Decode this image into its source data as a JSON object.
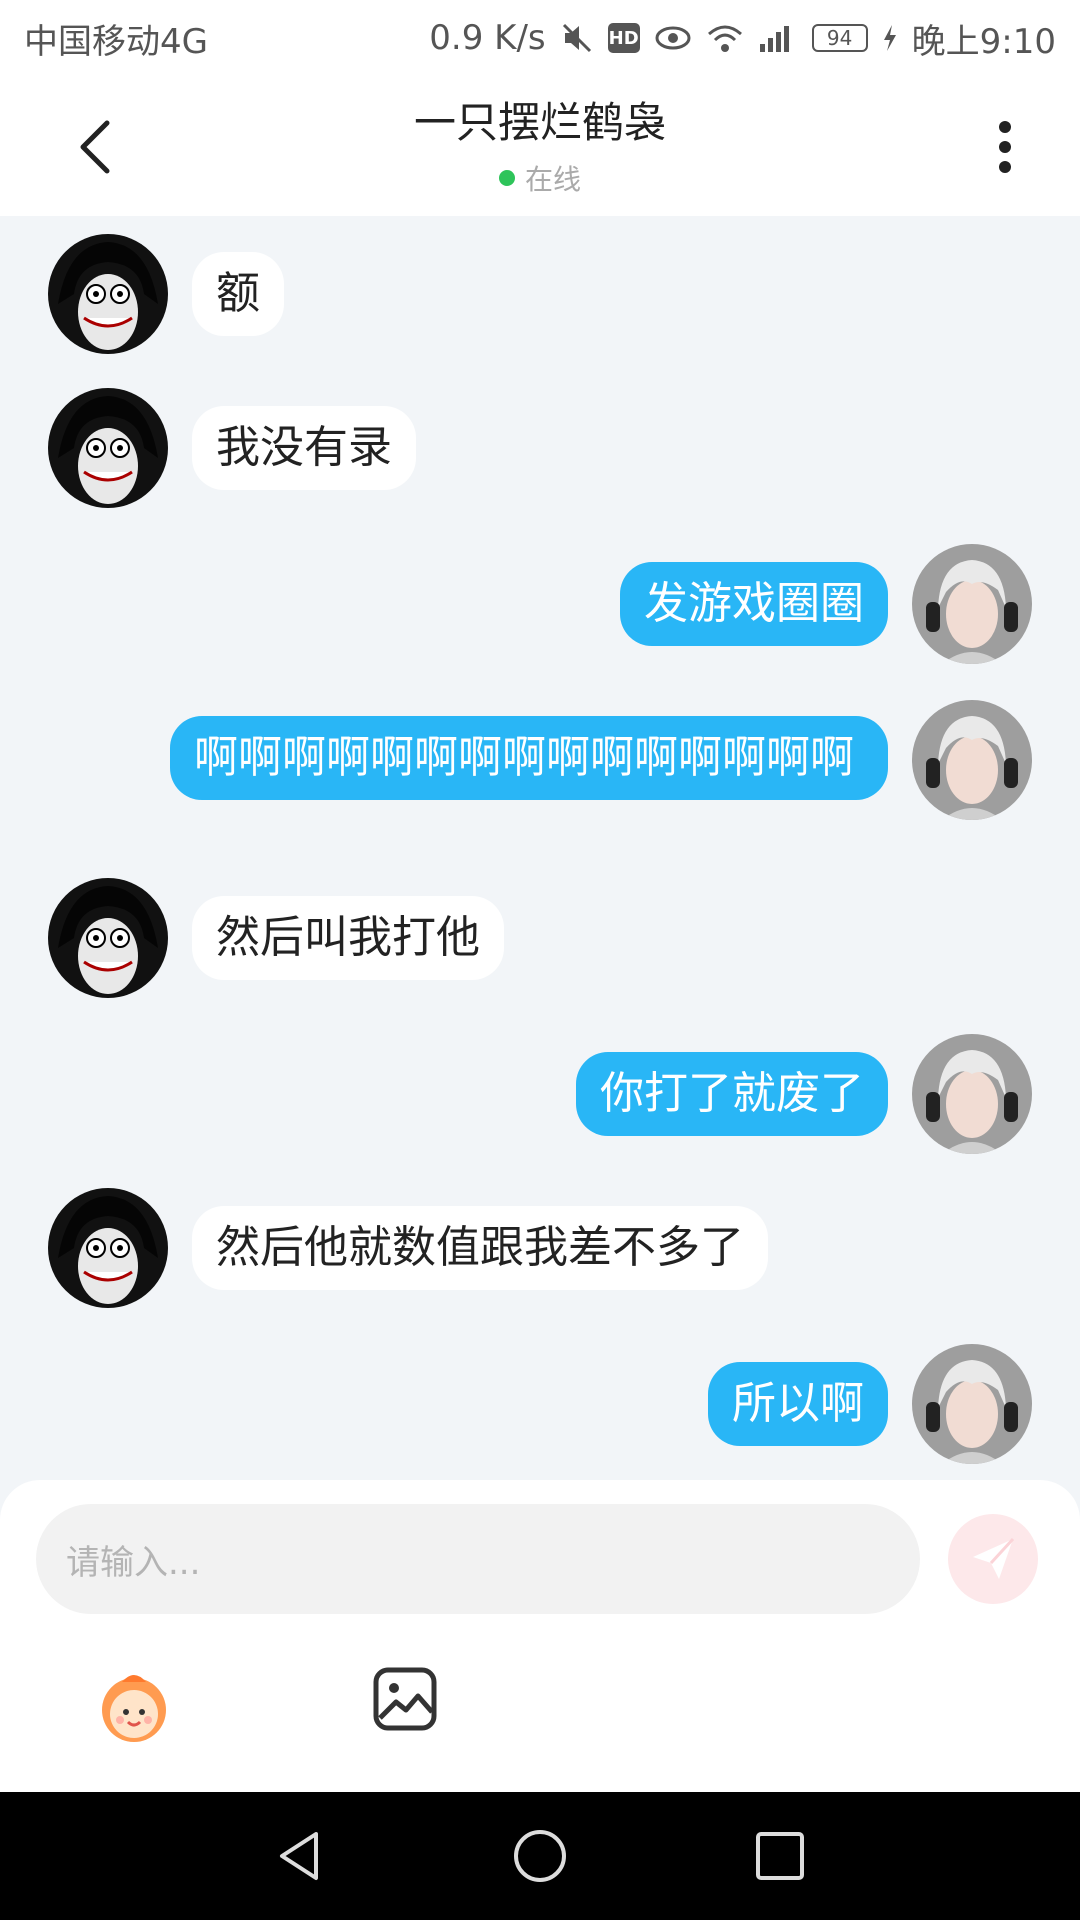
{
  "status_bar": {
    "carrier": "中国移动4G",
    "speed": "0.9 K/s",
    "hd": "HD",
    "battery": "94",
    "time": "晚上9:10"
  },
  "header": {
    "title": "一只摆烂鹤袅",
    "status": "在线"
  },
  "messages": [
    {
      "side": "left",
      "text": "额"
    },
    {
      "side": "left",
      "text": "我没有录"
    },
    {
      "side": "right",
      "text": "发游戏圈圈"
    },
    {
      "side": "right",
      "text": "啊啊啊啊啊啊啊啊啊啊啊啊啊啊啊"
    },
    {
      "side": "left",
      "text": "然后叫我打他"
    },
    {
      "side": "right",
      "text": "你打了就废了"
    },
    {
      "side": "left",
      "text": "然后他就数值跟我差不多了"
    },
    {
      "side": "right",
      "text": "所以啊"
    }
  ],
  "composer": {
    "placeholder": "请输入..."
  },
  "colors": {
    "accent": "#29b6f6",
    "online": "#2ec45a",
    "background": "#f2f5f8"
  },
  "icons": {
    "back": "back-icon",
    "more": "more-vertical-icon",
    "send": "send-icon",
    "emoji": "emoji-mascot-icon",
    "image": "image-icon"
  }
}
